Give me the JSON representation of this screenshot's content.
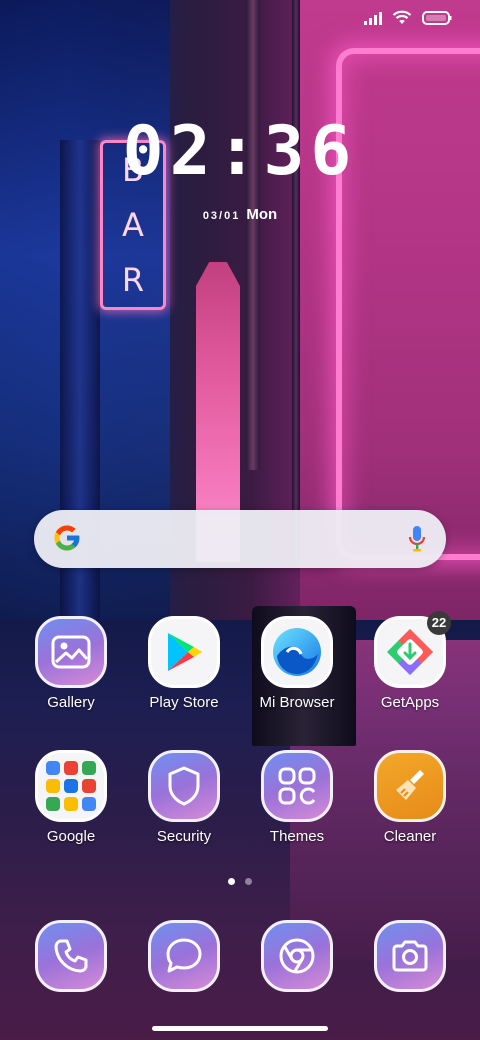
{
  "status_bar": {
    "signal": "signal-icon",
    "wifi": "wifi-icon",
    "battery": "battery-icon"
  },
  "clock": {
    "time": "02:36",
    "date": "03/01",
    "weekday": "Mon"
  },
  "search": {
    "logo": "google-g-icon",
    "mic": "microphone-icon"
  },
  "apps_row1": [
    {
      "label": "Gallery",
      "icon": "gallery-icon"
    },
    {
      "label": "Play Store",
      "icon": "play-store-icon"
    },
    {
      "label": "Mi Browser",
      "icon": "mi-browser-icon"
    },
    {
      "label": "GetApps",
      "icon": "getapps-icon",
      "badge": "22"
    }
  ],
  "apps_row2": [
    {
      "label": "Google",
      "icon": "google-folder-icon"
    },
    {
      "label": "Security",
      "icon": "shield-icon"
    },
    {
      "label": "Themes",
      "icon": "themes-icon"
    },
    {
      "label": "Cleaner",
      "icon": "broom-icon"
    }
  ],
  "dock": [
    {
      "icon": "phone-icon"
    },
    {
      "icon": "messages-icon"
    },
    {
      "icon": "chrome-icon"
    },
    {
      "icon": "camera-icon"
    }
  ],
  "page_indicator": {
    "pages": 2,
    "current": 1
  },
  "wallpaper": {
    "sign_text": "BAR"
  },
  "colors": {
    "neon_pink": "#ff7dd0",
    "icon_purple": "#9a72d9",
    "cleaner_orange": "#f3a82a"
  }
}
